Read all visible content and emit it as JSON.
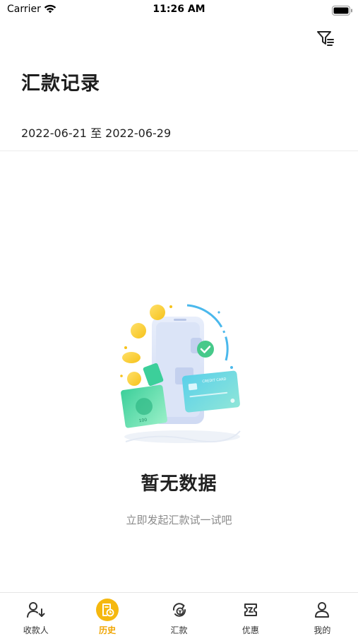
{
  "status_bar": {
    "carrier": "Carrier",
    "time": "11:26 AM"
  },
  "header": {
    "title": "汇款记录",
    "date_range": "2022-06-21 至 2022-06-29",
    "filter_icon": "filter-icon"
  },
  "empty_state": {
    "title": "暂无数据",
    "subtitle": "立即发起汇款试一试吧",
    "card_text": "CREDIT CARD",
    "note_text": "100"
  },
  "tabs": [
    {
      "label": "收款人",
      "icon": "person-arrow-icon",
      "active": false
    },
    {
      "label": "历史",
      "icon": "history-icon",
      "active": true
    },
    {
      "label": "汇款",
      "icon": "remit-icon",
      "active": false
    },
    {
      "label": "优惠",
      "icon": "coupon-icon",
      "active": false
    },
    {
      "label": "我的",
      "icon": "profile-icon",
      "active": false
    }
  ],
  "colors": {
    "accent": "#f5b80f",
    "active_label": "#f0a500",
    "text": "#222222",
    "muted": "#8a8a8a"
  }
}
